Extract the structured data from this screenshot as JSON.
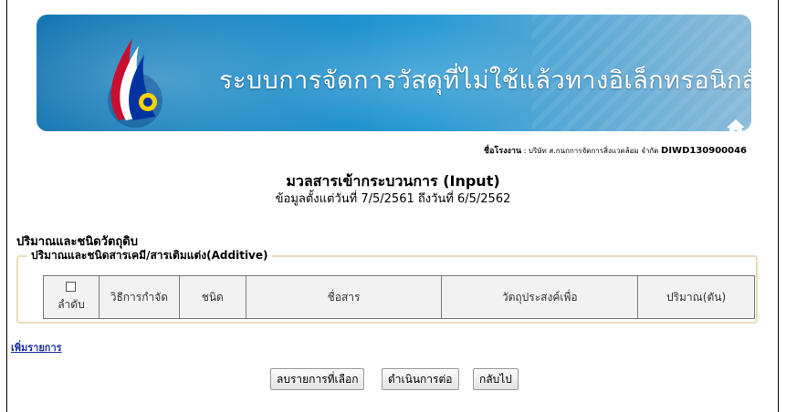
{
  "banner": {
    "title": "ระบบการจัดการวัสดุที่ไม่ใช้แล้วทางอิเล็กทรอนิกส์",
    "icons": [
      "home-icon",
      "mail-icon"
    ],
    "colors": {
      "primary": "#0a6fae",
      "secondary": "#5aa9d6"
    }
  },
  "factory": {
    "label": "ชื่อโรงงาน",
    "separator": " : ",
    "name": "บริษัท ส.กนกการจัดการสิ่งแวดล้อม จำกัด",
    "code": "DIWD130900046"
  },
  "page": {
    "title": "มวลสารเข้ากระบวนการ (Input)",
    "subtitle": "ข้อมูลตั้งแต่วันที่ 7/5/2561 ถึงวันที่ 6/5/2562"
  },
  "section": {
    "title": "ปริมาณและชนิดวัตถุดิบ",
    "fieldset_legend": "ปริมาณและชนิดสารเคมี/สารเติมแต่ง(Additive)"
  },
  "table": {
    "columns": [
      "ลำดับ",
      "วิธีการกำจัด",
      "ชนิด",
      "ชื่อสาร",
      "วัตถุประสงค์เพื่อ",
      "ปริมาณ(ตัน)"
    ],
    "rows": []
  },
  "actions": {
    "add_item": "เพิ่มรายการ",
    "delete_selected": "ลบรายการที่เลือก",
    "continue": "ดำเนินการต่อ",
    "back": "กลับไป"
  }
}
